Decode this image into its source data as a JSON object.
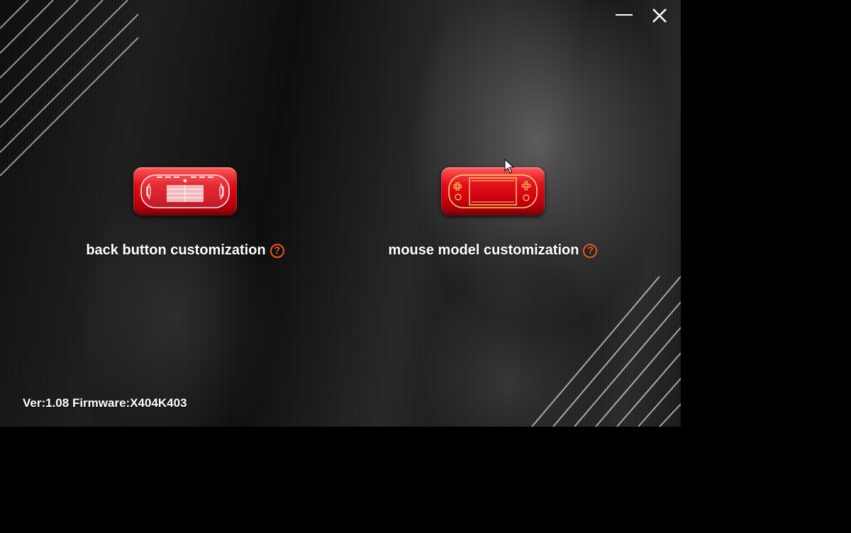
{
  "window": {
    "controls": {
      "minimize_icon": "minimize-icon",
      "close_icon": "close-icon"
    }
  },
  "features": [
    {
      "label": "back button customization",
      "icon": "handheld-back-panel-icon",
      "help_glyph": "?"
    },
    {
      "label": "mouse model customization",
      "icon": "handheld-console-icon",
      "help_glyph": "?"
    }
  ],
  "footer": {
    "version_text": "Ver:1.08 Firmware:X404K403"
  },
  "colors": {
    "accent_red": "#d40012",
    "help_orange": "#e8572a",
    "device_line": "#f5d66a",
    "text": "#ffffff"
  }
}
